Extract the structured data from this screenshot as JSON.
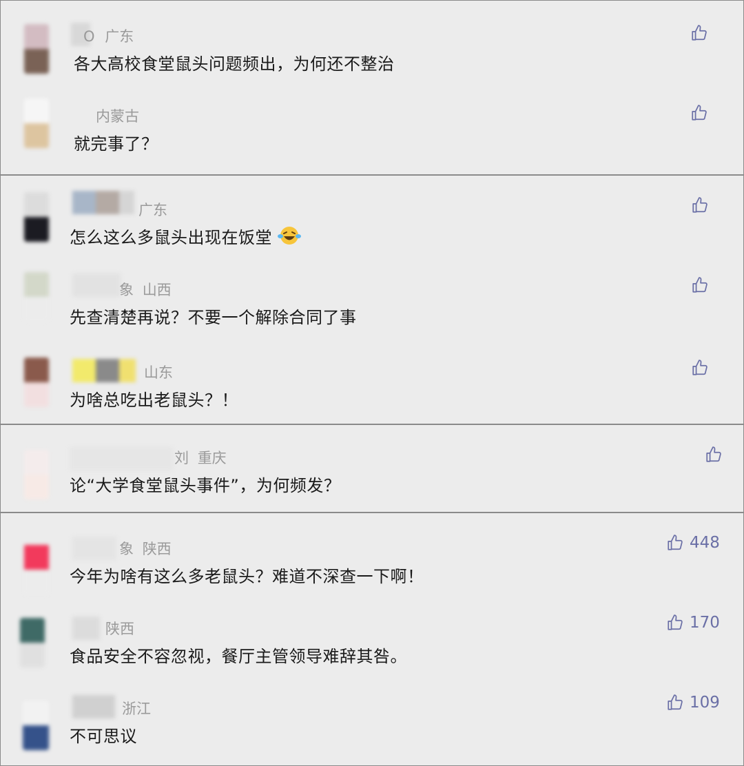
{
  "colors": {
    "panel_background": "#ececec",
    "panel_border": "#8a8a8a",
    "meta_text": "#9a9a9a",
    "comment_text": "#1a1a1a",
    "like_icon": "#6a6fa6"
  },
  "panels": [
    {
      "comments": [
        {
          "nickname_fragment": "O",
          "location": "广东",
          "text": "各大高校食堂鼠头问题频出，为何还不整治",
          "like_icon": "thumbs-up-icon",
          "likes": ""
        },
        {
          "nickname_fragment": "",
          "location": "内蒙古",
          "text": "就完事了？",
          "like_icon": "thumbs-up-icon",
          "likes": ""
        }
      ]
    },
    {
      "comments": [
        {
          "nickname_fragment": "",
          "location": "广东",
          "text": "怎么这么多鼠头出现在饭堂",
          "emoji": "grinning-squinting-tears-emoji",
          "like_icon": "thumbs-up-icon",
          "likes": ""
        },
        {
          "nickname_fragment": "象",
          "location": "山西",
          "text": "先查清楚再说？不要一个解除合同了事",
          "like_icon": "thumbs-up-icon",
          "likes": ""
        },
        {
          "nickname_fragment": "",
          "location": "山东",
          "text": "为啥总吃出老鼠头？！",
          "like_icon": "thumbs-up-icon",
          "likes": ""
        }
      ]
    },
    {
      "comments": [
        {
          "nickname_fragment": "刘",
          "location": "重庆",
          "text": "论“大学食堂鼠头事件”，为何频发？",
          "like_icon": "thumbs-up-icon",
          "likes": ""
        }
      ]
    },
    {
      "comments": [
        {
          "nickname_fragment": "象",
          "location": "陕西",
          "text": "今年为啥有这么多老鼠头？难道不深查一下啊！",
          "like_icon": "thumbs-up-icon",
          "likes": "448"
        },
        {
          "nickname_fragment": "",
          "location": "陕西",
          "text": "食品安全不容忽视，餐厅主管领导难辞其咎。",
          "like_icon": "thumbs-up-icon",
          "likes": "170"
        },
        {
          "nickname_fragment": "",
          "location": "浙江",
          "text": "不可思议",
          "like_icon": "thumbs-up-icon",
          "likes": "109"
        }
      ]
    }
  ]
}
